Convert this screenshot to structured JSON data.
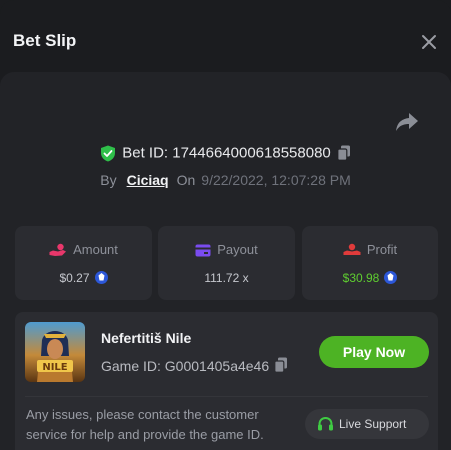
{
  "header": {
    "title": "Bet Slip"
  },
  "bet": {
    "id_label": "Bet ID:",
    "id": "1744664000618558080",
    "by_label": "By",
    "user": "Ciciaq",
    "on_label": "On",
    "datetime": "9/22/2022, 12:07:28 PM"
  },
  "stats": [
    {
      "label": "Amount",
      "value": "$0.27",
      "icon": "hand-coin-icon",
      "color": "#e8376b"
    },
    {
      "label": "Payout",
      "value": "111.72 x",
      "icon": "card-icon",
      "color": "#7a4cf0"
    },
    {
      "label": "Profit",
      "value": "$30.98",
      "icon": "hand-coin-icon",
      "color": "#e03b3b"
    }
  ],
  "game": {
    "name": "Nefertitiš Nile",
    "id_label": "Game ID:",
    "id": "G0001405a4e46",
    "play_label": "Play Now",
    "thumb_text": "NILE"
  },
  "footer": {
    "issues_text": "Any issues, please contact the customer service for help and provide the game ID.",
    "support_label": "Live Support"
  },
  "colors": {
    "accent_green": "#4db324",
    "profit_green": "#5fce30",
    "shield_green": "#2fbf4a",
    "panel": "#222327",
    "card": "#2b2c31"
  }
}
